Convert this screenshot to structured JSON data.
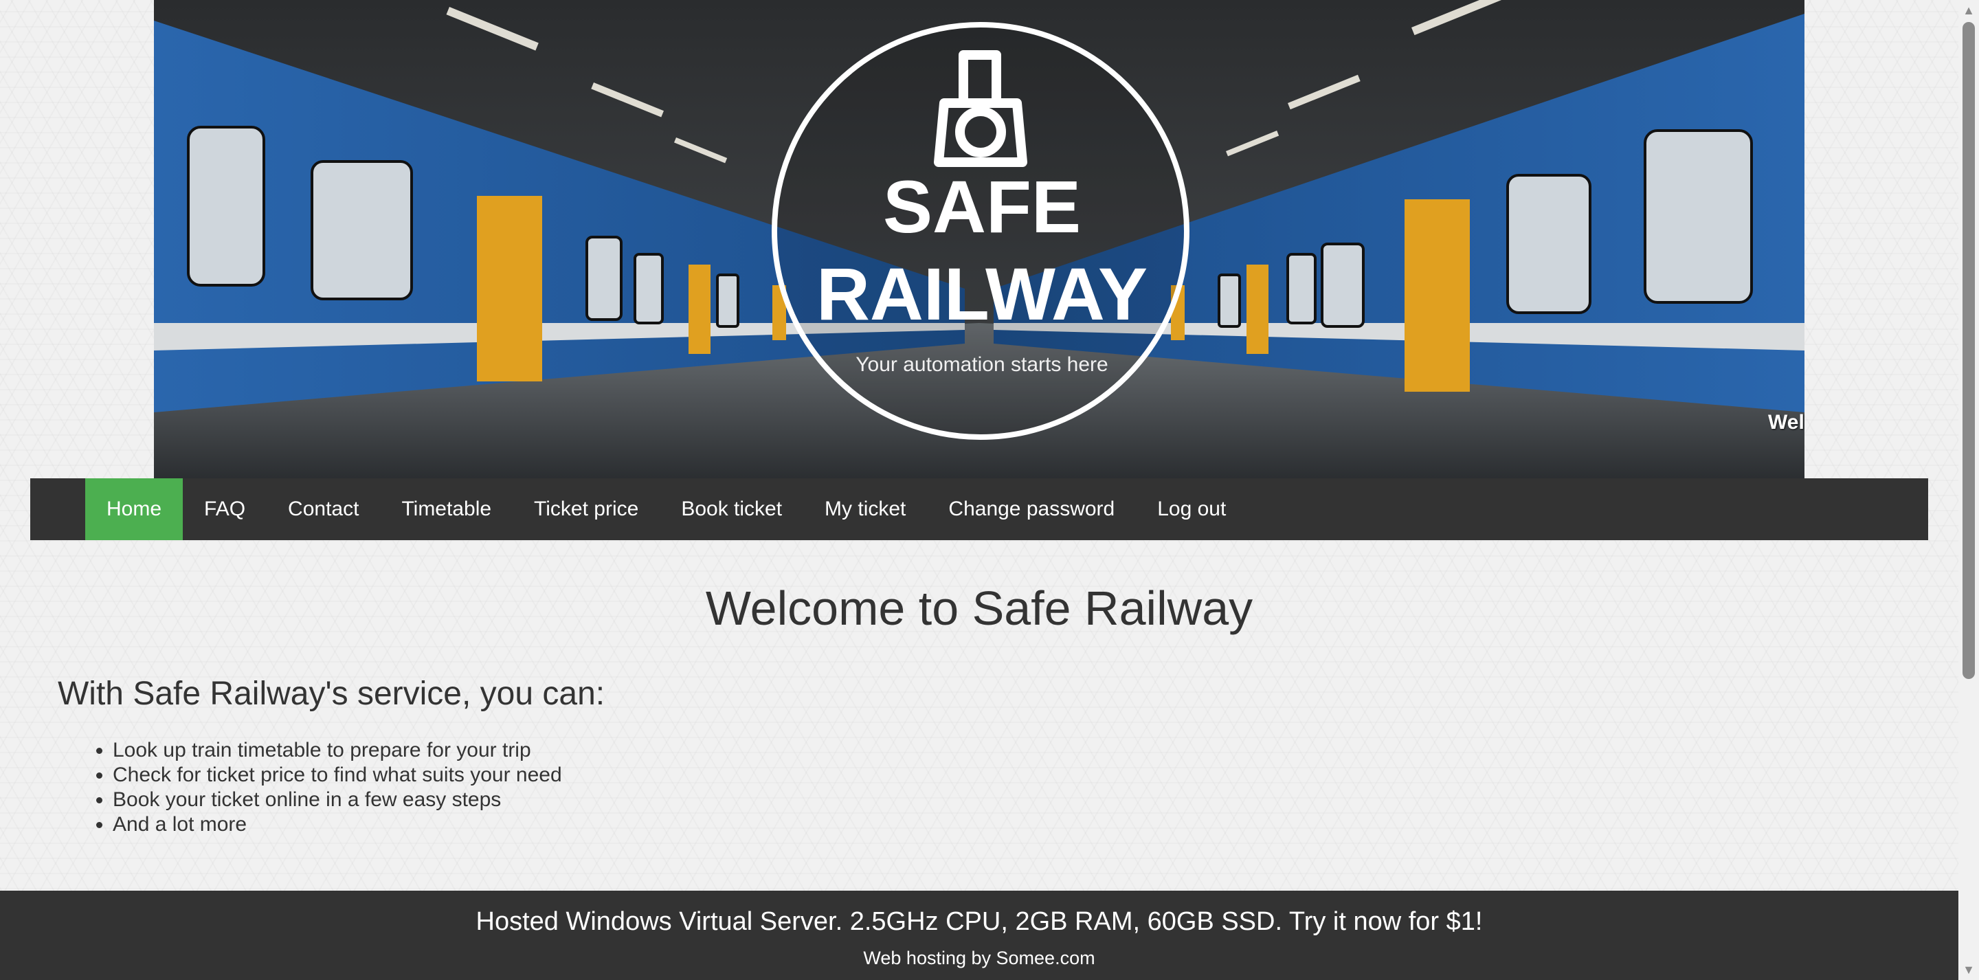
{
  "banner": {
    "logo_line1": "SAFE",
    "logo_line2": "RAILWAY",
    "tagline": "Your automation starts here",
    "welcome": "Welcome kingohong@gmail.com"
  },
  "nav": {
    "items": [
      {
        "label": "Home",
        "active": true
      },
      {
        "label": "FAQ"
      },
      {
        "label": "Contact"
      },
      {
        "label": "Timetable"
      },
      {
        "label": "Ticket price"
      },
      {
        "label": "Book ticket"
      },
      {
        "label": "My ticket"
      },
      {
        "label": "Change password"
      },
      {
        "label": "Log out"
      }
    ]
  },
  "main": {
    "title": "Welcome to Safe Railway",
    "subtitle": "With Safe Railway's service, you can:",
    "features": [
      "Look up train timetable to prepare for your trip",
      "Check for ticket price to find what suits your need",
      "Book your ticket online in a few easy steps",
      "And a lot more"
    ]
  },
  "footer": {
    "ad": "Hosted Windows Virtual Server. 2.5GHz CPU, 2GB RAM, 60GB SSD. Try it now for $1!",
    "hosting": "Web hosting by Somee.com"
  },
  "colors": {
    "nav_bg": "#333333",
    "nav_active": "#4caf50",
    "footer_bg": "#333333",
    "train_blue": "#2f6fb3",
    "door_yellow": "#e0a020"
  },
  "icons": {
    "logo": "locomotive-icon",
    "scroll_up": "arrow-up-icon",
    "scroll_down": "arrow-down-icon"
  }
}
